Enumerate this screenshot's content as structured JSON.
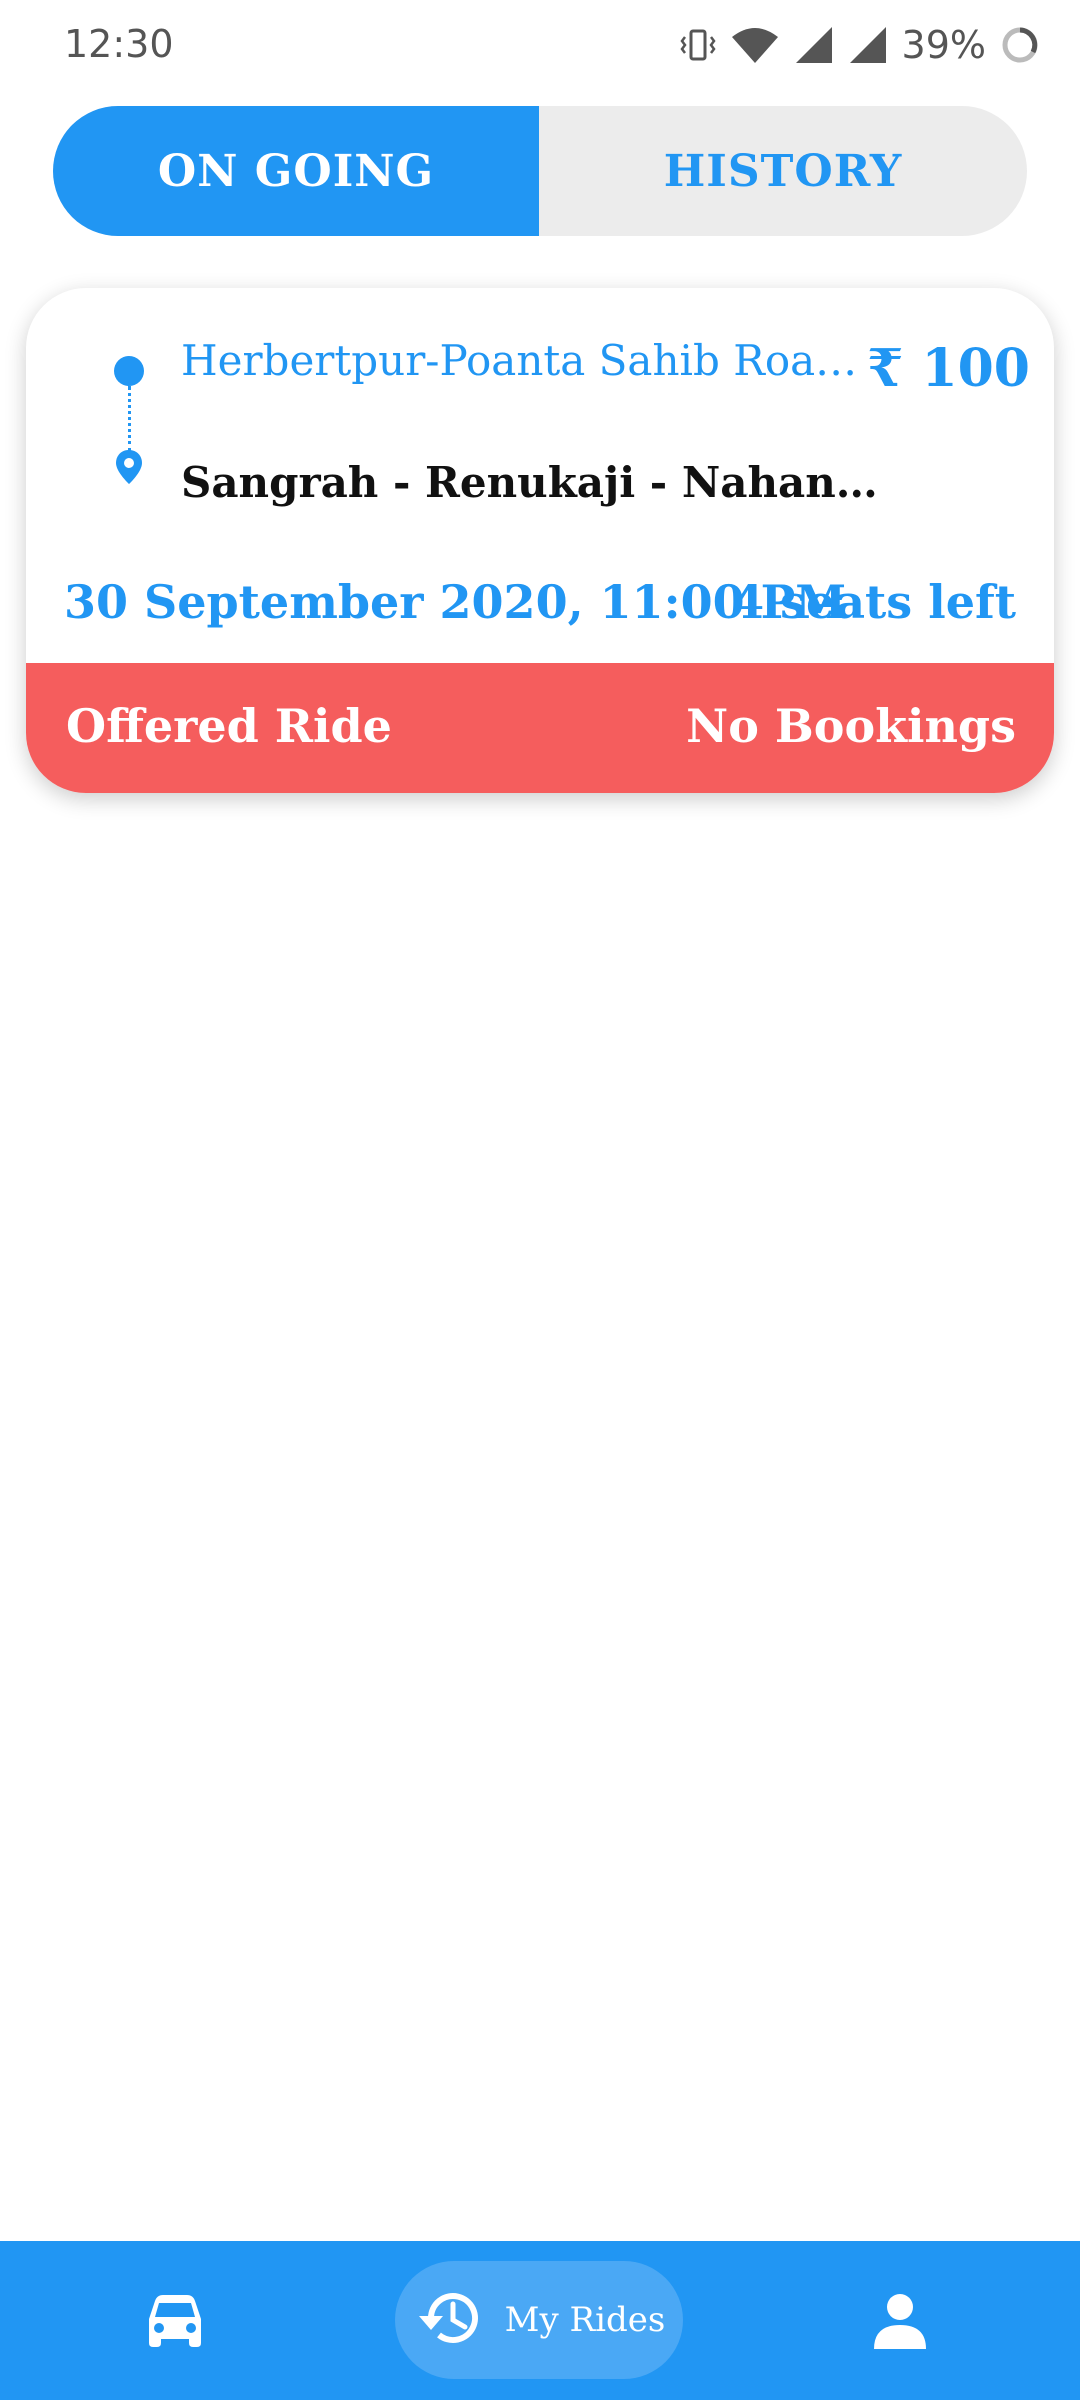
{
  "status_bar": {
    "time": "12:30",
    "battery": "39%"
  },
  "tabs": [
    {
      "label": "ON GOING",
      "active": true
    },
    {
      "label": "HISTORY",
      "active": false
    }
  ],
  "ride": {
    "from": "Herbertpur-Poanta Sahib Road,...",
    "to": "Sangrah - Renukaji - Nahan Roa...",
    "price": "₹ 100",
    "datetime": "30 September 2020, 11:00 PM",
    "seats": "4 seats left",
    "type": "Offered Ride",
    "booking_status": "No Bookings"
  },
  "bottom_nav": {
    "items": [
      {
        "icon": "car-icon"
      },
      {
        "icon": "history-icon",
        "label": "My Rides",
        "active": true
      },
      {
        "icon": "person-icon"
      }
    ]
  },
  "colors": {
    "accent": "#2196f3",
    "alert": "#f55d5d",
    "tab_bg": "#ececec"
  }
}
